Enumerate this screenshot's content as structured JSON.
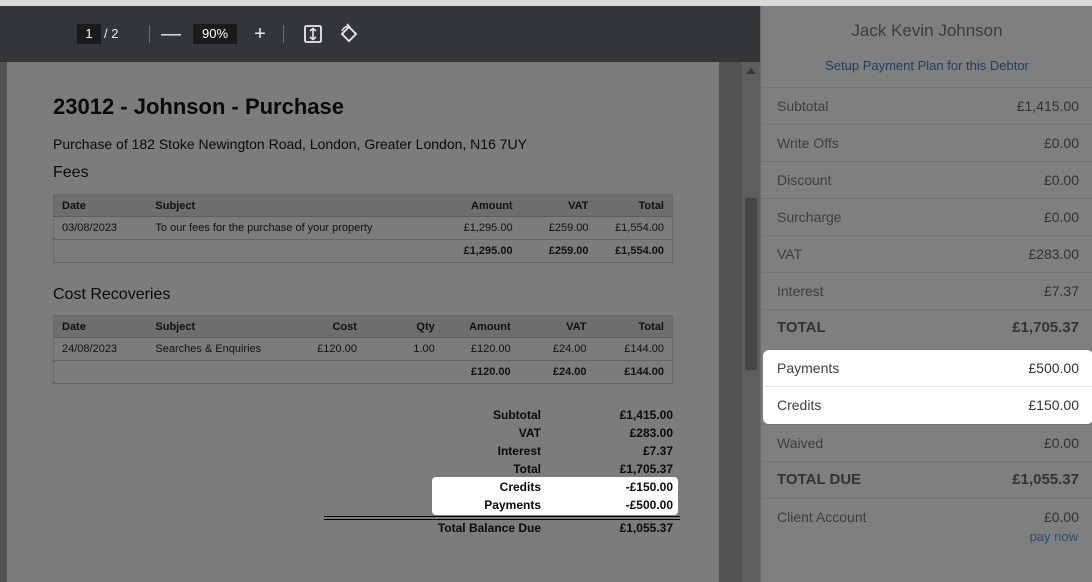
{
  "toolbar": {
    "current_page": "1",
    "page_separator": "/ 2",
    "zoom_out": "—",
    "zoom_level": "90%",
    "zoom_in": "+"
  },
  "document": {
    "title": "23012 - Johnson - Purchase",
    "subtitle": "Purchase of 182 Stoke Newington Road, London, Greater London, N16 7UY",
    "fees": {
      "heading": "Fees",
      "columns": [
        "Date",
        "Subject",
        "Amount",
        "VAT",
        "Total"
      ],
      "rows": [
        [
          "03/08/2023",
          "To our fees for the purchase of your property",
          "£1,295.00",
          "£259.00",
          "£1,554.00"
        ]
      ],
      "totals": [
        "£1,295.00",
        "£259.00",
        "£1,554.00"
      ]
    },
    "costs": {
      "heading": "Cost Recoveries",
      "columns": [
        "Date",
        "Subject",
        "Cost",
        "Qty",
        "Amount",
        "VAT",
        "Total"
      ],
      "rows": [
        [
          "24/08/2023",
          "Searches & Enquiries",
          "£120.00",
          "1.00",
          "£120.00",
          "£24.00",
          "£144.00"
        ]
      ],
      "totals": [
        "£120.00",
        "£24.00",
        "£144.00"
      ]
    },
    "summary": [
      {
        "label": "Subtotal",
        "value": "£1,415.00"
      },
      {
        "label": "VAT",
        "value": "£283.00"
      },
      {
        "label": "Interest",
        "value": "£7.37"
      },
      {
        "label": "Total",
        "value": "£1,705.37"
      },
      {
        "label": "Credits",
        "value": "-£150.00"
      },
      {
        "label": "Payments",
        "value": "-£500.00"
      }
    ],
    "balance_label": "Total Balance Due",
    "balance_value": "£1,055.37"
  },
  "sidebar": {
    "debtor_name": "Jack Kevin Johnson",
    "plan_link": "Setup Payment Plan for this Debtor",
    "rows": [
      {
        "label": "Subtotal",
        "value": "£1,415.00"
      },
      {
        "label": "Write Offs",
        "value": "£0.00"
      },
      {
        "label": "Discount",
        "value": "£0.00"
      },
      {
        "label": "Surcharge",
        "value": "£0.00"
      },
      {
        "label": "VAT",
        "value": "£283.00"
      },
      {
        "label": "Interest",
        "value": "£7.37"
      },
      {
        "label": "TOTAL",
        "value": "£1,705.37"
      },
      {
        "label": "Payments",
        "value": "£500.00"
      },
      {
        "label": "Credits",
        "value": "£150.00"
      },
      {
        "label": "Waived",
        "value": "£0.00"
      },
      {
        "label": "TOTAL DUE",
        "value": "£1,055.37"
      },
      {
        "label": "Client Account",
        "value": "£0.00"
      }
    ],
    "pay_now": "pay now"
  }
}
